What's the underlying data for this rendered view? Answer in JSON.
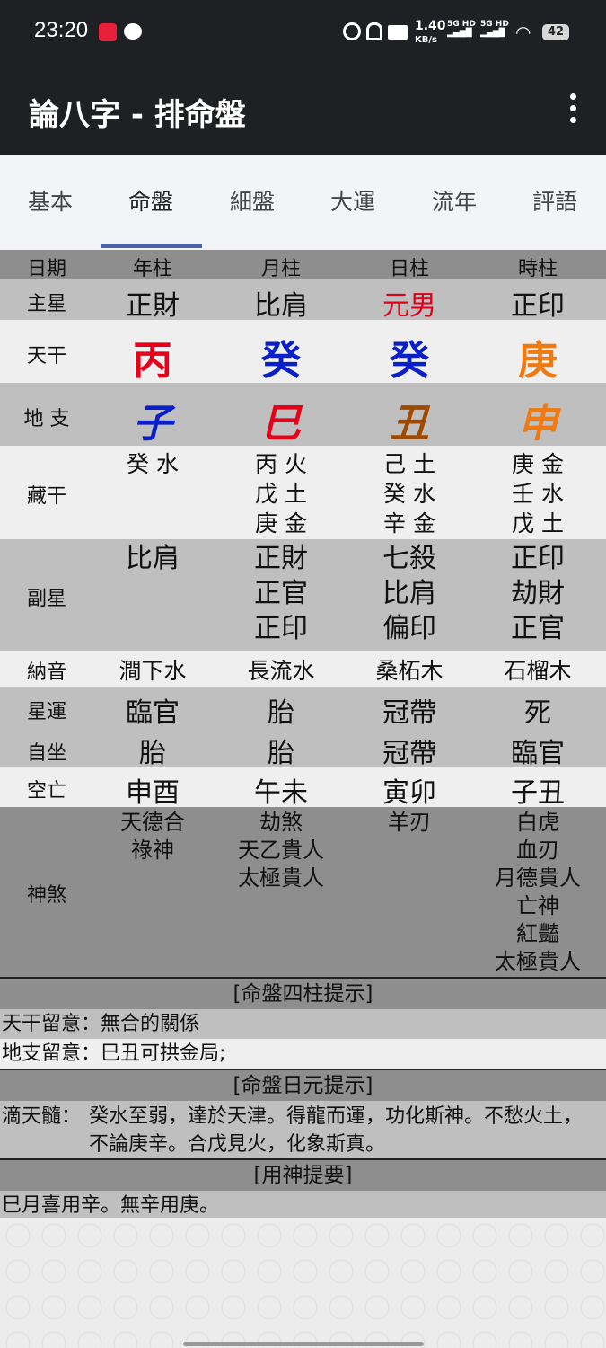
{
  "status": {
    "time": "23:20",
    "speed": "1.40",
    "speed_unit": "KB/s",
    "battery": "42",
    "net1": "5G HD",
    "net2": "5G HD"
  },
  "app": {
    "title": "論八字 - 排命盤"
  },
  "tabs": [
    "基本",
    "命盤",
    "細盤",
    "大運",
    "流年",
    "評語"
  ],
  "active_tab": 1,
  "header": {
    "label": "日期",
    "cols": [
      "年柱",
      "月柱",
      "日柱",
      "時柱"
    ]
  },
  "main_star": {
    "label": "主星",
    "values": [
      "正財",
      "比肩",
      "元男",
      "正印"
    ],
    "colors": [
      "#111111",
      "#111111",
      "#e0001b",
      "#111111"
    ]
  },
  "heaven_stem": {
    "label": "天干",
    "values": [
      "丙",
      "癸",
      "癸",
      "庚"
    ],
    "colors": [
      "#e8001b",
      "#0a1fc8",
      "#0a1fc8",
      "#f07a12"
    ]
  },
  "earth_branch": {
    "label": "地 支",
    "values": [
      "子",
      "巳",
      "丑",
      "申"
    ],
    "colors": [
      "#0a1fc8",
      "#e8001b",
      "#a04a00",
      "#f07a12"
    ]
  },
  "hidden_stems": {
    "label": "藏干",
    "values": [
      [
        "癸 水"
      ],
      [
        "丙 火",
        "戊 土",
        "庚 金"
      ],
      [
        "己 土",
        "癸 水",
        "辛 金"
      ],
      [
        "庚 金",
        "壬 水",
        "戊 土"
      ]
    ]
  },
  "sub_star": {
    "label": "副星",
    "values": [
      [
        "比肩"
      ],
      [
        "正財",
        "正官",
        "正印"
      ],
      [
        "七殺",
        "比肩",
        "偏印"
      ],
      [
        "正印",
        "劫財",
        "正官"
      ]
    ]
  },
  "nayin": {
    "label": "納音",
    "values": [
      "澗下水",
      "長流水",
      "桑柘木",
      "石榴木"
    ]
  },
  "star_luck": {
    "label": "星運",
    "values": [
      "臨官",
      "胎",
      "冠帶",
      "死"
    ]
  },
  "self_sit": {
    "label": "自坐",
    "values": [
      "胎",
      "胎",
      "冠帶",
      "臨官"
    ]
  },
  "void": {
    "label": "空亡",
    "values": [
      "申酉",
      "午未",
      "寅卯",
      "子丑"
    ]
  },
  "shensha": {
    "label": "神煞",
    "values": [
      [
        "天德合",
        "祿神"
      ],
      [
        "劫煞",
        "天乙貴人",
        "太極貴人"
      ],
      [
        "羊刃"
      ],
      [
        "白虎",
        "血刃",
        "月德貴人",
        "亡神",
        "紅豔",
        "太極貴人"
      ]
    ]
  },
  "section1": {
    "title": "[命盤四柱提示]",
    "line1": "天干留意：無合的關係",
    "line2": "地支留意：巳丑可拱金局;"
  },
  "section2": {
    "title": "[命盤日元提示]",
    "label": "滴天髓：",
    "text1": "癸水至弱，達於天津。得龍而運，功化斯神。不愁火土，",
    "text2": "不論庚辛。合戊見火，化象斯真。"
  },
  "section3": {
    "title": "[用神提要]",
    "text": "巳月喜用辛。無辛用庚。"
  }
}
